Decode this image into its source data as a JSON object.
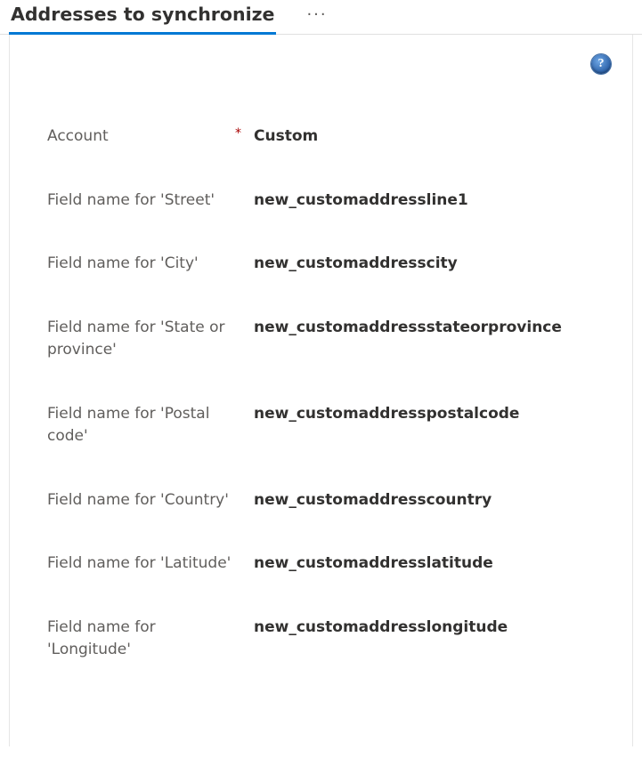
{
  "header": {
    "tab_label": "Addresses to synchronize",
    "ellipsis": "···"
  },
  "help": {
    "glyph": "?",
    "name": "help-icon"
  },
  "form": {
    "rows": [
      {
        "label": "Account",
        "required": true,
        "value": "Custom",
        "name": "account"
      },
      {
        "label": "Field name for 'Street'",
        "required": false,
        "value": "new_customaddressline1",
        "name": "street"
      },
      {
        "label": "Field name for 'City'",
        "required": false,
        "value": "new_customaddresscity",
        "name": "city"
      },
      {
        "label": "Field name for 'State or province'",
        "required": false,
        "value": "new_customaddressstateorprovince",
        "name": "state-or-province"
      },
      {
        "label": "Field name for 'Postal code'",
        "required": false,
        "value": "new_customaddresspostalcode",
        "name": "postal-code"
      },
      {
        "label": "Field name for 'Country'",
        "required": false,
        "value": "new_customaddresscountry",
        "name": "country"
      },
      {
        "label": "Field name for 'Latitude'",
        "required": false,
        "value": "new_customaddresslatitude",
        "name": "latitude"
      },
      {
        "label": "Field name for 'Longitude'",
        "required": false,
        "value": "new_customaddresslongitude",
        "name": "longitude"
      }
    ]
  }
}
